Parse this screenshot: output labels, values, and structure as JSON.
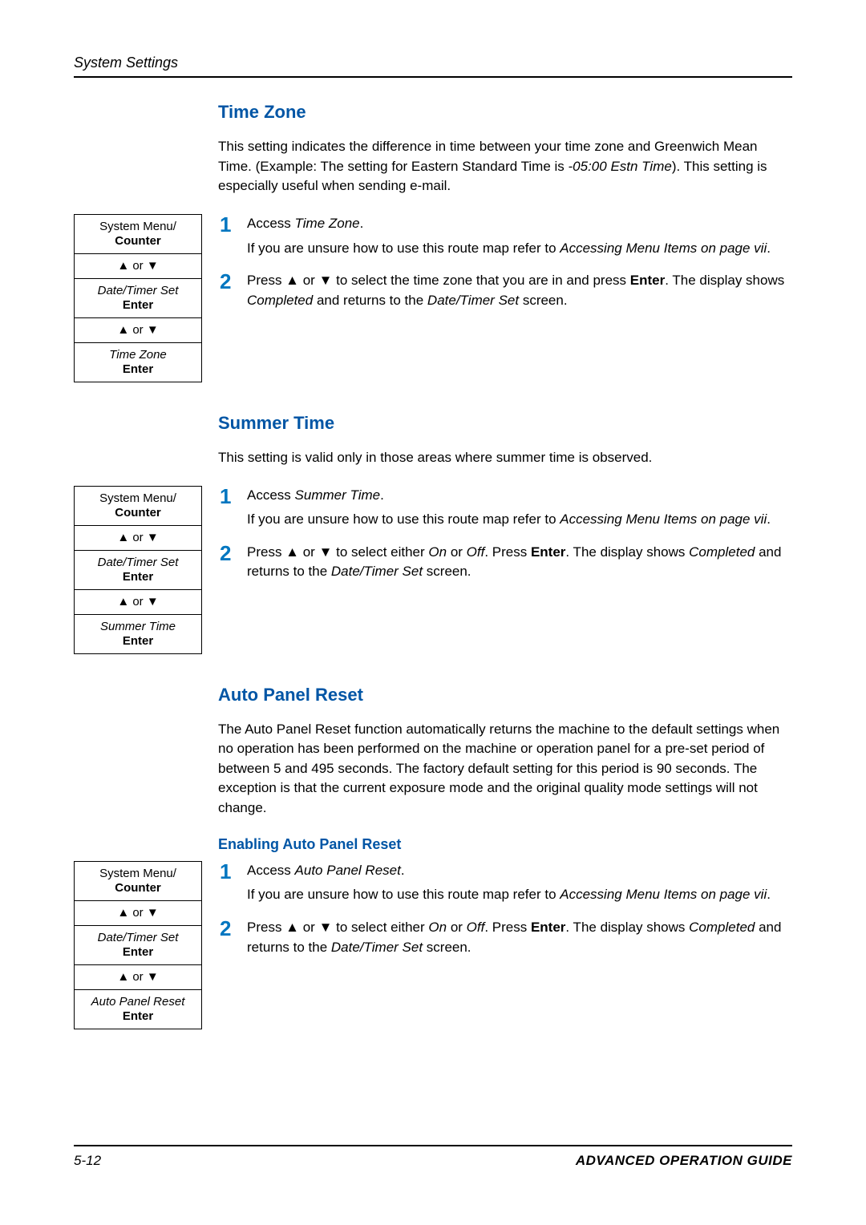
{
  "runningHead": "System Settings",
  "sections": {
    "timeZone": {
      "title": "Time Zone",
      "introParts": [
        "This setting indicates the difference in time between your time zone and Greenwich Mean Time. (Example: The setting for Eastern Standard Time is ",
        "-05:00 Estn Time",
        "). This setting is especially useful when sending e-mail."
      ],
      "menu": {
        "a": "System Menu/",
        "aBold": "Counter",
        "arrows": "▲ or ▼",
        "b": "Date/Timer Set",
        "bBold": "Enter",
        "arrows2": "▲ or ▼",
        "c": "Time Zone",
        "cBold": "Enter"
      },
      "step1": {
        "lead": "Access ",
        "target": "Time Zone",
        "period": ".",
        "ref1": "If you are unsure how to use this route map refer to ",
        "refItal": "Accessing Menu Items on page vii",
        "refEnd": "."
      },
      "step2": {
        "p1": "Press ▲ or ▼ to select the time zone that you are in and press ",
        "enter": "Enter",
        "p2": ". The display shows ",
        "completed": "Completed",
        "p3": " and returns to the ",
        "screen": "Date/Timer Set",
        "p4": " screen."
      }
    },
    "summerTime": {
      "title": "Summer Time",
      "intro": "This setting is valid only in those areas where summer time is observed.",
      "menu": {
        "a": "System Menu/",
        "aBold": "Counter",
        "arrows": "▲ or ▼",
        "b": "Date/Timer Set",
        "bBold": "Enter",
        "arrows2": "▲ or ▼",
        "c": "Summer Time",
        "cBold": "Enter"
      },
      "step1": {
        "lead": "Access ",
        "target": "Summer Time",
        "period": ".",
        "ref1": "If you are unsure how to use this route map refer to ",
        "refItal": "Accessing Menu Items on page vii",
        "refEnd": "."
      },
      "step2": {
        "p1": "Press ▲ or ▼ to select either ",
        "on": "On",
        "or": " or ",
        "off": "Off",
        "p2": ". Press ",
        "enter": "Enter",
        "p3": ". The display shows ",
        "completed": "Completed",
        "p4": " and returns to the ",
        "screen": "Date/Timer Set",
        "p5": " screen."
      }
    },
    "autoPanel": {
      "title": "Auto Panel Reset",
      "intro": "The Auto Panel Reset function automatically returns the machine to the default settings when no operation has been performed on the machine or operation panel for a pre-set period of between 5 and 495 seconds. The factory default setting for this period is 90 seconds. The exception is that the current exposure mode and the original quality mode settings will not change.",
      "sub": "Enabling Auto Panel Reset",
      "menu": {
        "a": "System Menu/",
        "aBold": "Counter",
        "arrows": "▲ or ▼",
        "b": "Date/Timer Set",
        "bBold": "Enter",
        "arrows2": "▲ or ▼",
        "c": "Auto Panel Reset",
        "cBold": "Enter"
      },
      "step1": {
        "lead": "Access ",
        "target": "Auto Panel Reset",
        "period": ".",
        "ref1": "If you are unsure how to use this route map refer to ",
        "refItal": "Accessing Menu Items on page vii",
        "refEnd": "."
      },
      "step2": {
        "p1": "Press ▲ or ▼ to select either ",
        "on": "On",
        "or": " or ",
        "off": "Off",
        "p2": ". Press ",
        "enter": "Enter",
        "p3": ". The display shows ",
        "completed": "Completed",
        "p4": " and returns to the ",
        "screen": "Date/Timer Set",
        "p5": " screen."
      }
    }
  },
  "footer": {
    "pageNum": "5-12",
    "guide": "ADVANCED OPERATION GUIDE"
  },
  "stepNums": {
    "one": "1",
    "two": "2"
  }
}
